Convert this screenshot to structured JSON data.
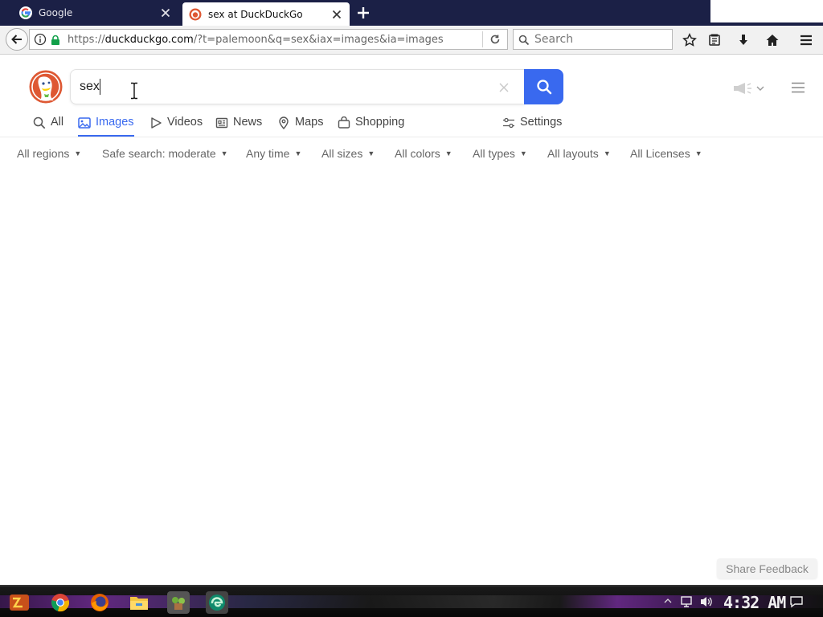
{
  "browser": {
    "tabs": [
      {
        "title": "Google",
        "favicon": "google-icon",
        "active": false
      },
      {
        "title": "sex at DuckDuckGo",
        "favicon": "duckduckgo-icon",
        "active": true
      }
    ],
    "url": {
      "scheme": "https://",
      "host": "duckduckgo.com",
      "path": "/?t=palemoon&q=sex&iax=images&ia=images"
    },
    "search_placeholder": "Search"
  },
  "ddg": {
    "query": "sex",
    "verticals": [
      {
        "label": "All",
        "icon": "search-icon"
      },
      {
        "label": "Images",
        "icon": "image-icon",
        "active": true
      },
      {
        "label": "Videos",
        "icon": "play-icon"
      },
      {
        "label": "News",
        "icon": "newspaper-icon"
      },
      {
        "label": "Maps",
        "icon": "map-pin-icon"
      },
      {
        "label": "Shopping",
        "icon": "shopping-bag-icon"
      }
    ],
    "settings_label": "Settings",
    "filters": [
      "All regions",
      "Safe search: moderate",
      "Any time",
      "All sizes",
      "All colors",
      "All types",
      "All layouts",
      "All Licenses"
    ],
    "feedback_label": "Share Feedback",
    "accent_color": "#3969ef"
  },
  "taskbar": {
    "clock": "4:32 AM",
    "apps": [
      "start-icon",
      "chrome-icon",
      "firefox-icon",
      "file-explorer-icon",
      "game-icon",
      "edge-icon"
    ]
  }
}
